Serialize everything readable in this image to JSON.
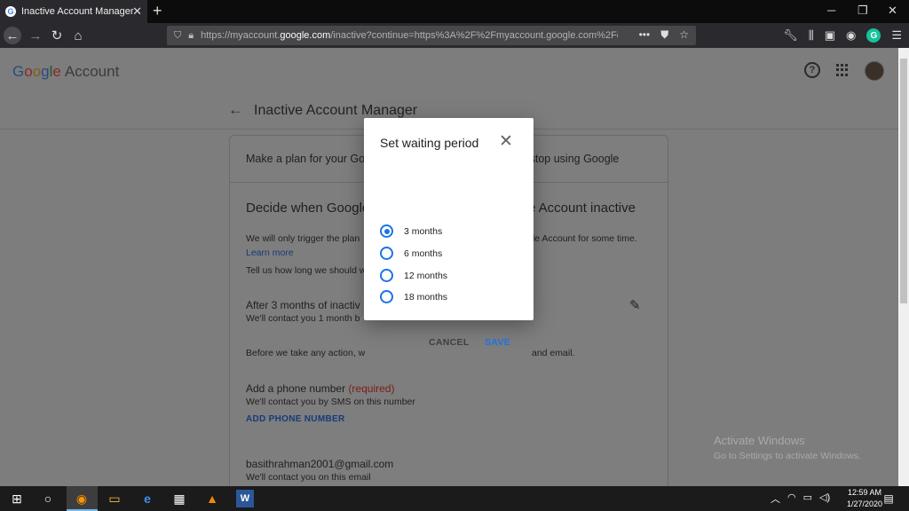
{
  "browser": {
    "tab_title": "Inactive Account Manager",
    "tab_favicon": "G",
    "url_prefix": "https://myaccount.",
    "url_domain": "google.com",
    "url_rest": "/inactive?continue=https%3A%2F%2Fmyaccount.google.com%2Fdata-",
    "url_more": "•••"
  },
  "header": {
    "logo_g": "G",
    "logo_o1": "o",
    "logo_o2": "o",
    "logo_g2": "g",
    "logo_l": "l",
    "logo_e": "e",
    "logo_account": "Account",
    "help": "?"
  },
  "main": {
    "page_title": "Inactive Account Manager",
    "lead": "Make a plan for your Google Account if you pass away or stop using Google",
    "heading_left": "Decide when Google",
    "heading_right": "e Account inactive",
    "trigger_left": "We will only trigger the plan",
    "trigger_right": "gle Account for some time.",
    "learn_more": "Learn more",
    "tell_us": "Tell us how long we should w",
    "after_months": "After 3 months of inactiv",
    "contact_month": "We'll contact you 1 month b",
    "before_action_left": "Before we take any action, w",
    "before_action_right": "and email.",
    "phone_label": "Add a phone number",
    "phone_required": "(required)",
    "phone_sub": "We'll contact you by SMS on this number",
    "add_phone": "ADD PHONE NUMBER",
    "email": "basithrahman2001@gmail.com",
    "email_sub": "We'll contact you on this email"
  },
  "dialog": {
    "title": "Set waiting period",
    "options": [
      {
        "label": "3 months",
        "checked": true
      },
      {
        "label": "6 months",
        "checked": false
      },
      {
        "label": "12 months",
        "checked": false
      },
      {
        "label": "18 months",
        "checked": false
      }
    ],
    "cancel": "CANCEL",
    "save": "SAVE"
  },
  "watermark": {
    "line1": "Activate Windows",
    "line2": "Go to Settings to activate Windows."
  },
  "taskbar": {
    "time": "12:59 AM",
    "date": "1/27/2020",
    "word_label": "W"
  },
  "colors": {
    "accent": "#1a73e8",
    "overlay_page": "#7d7d7d",
    "required": "#d93025"
  }
}
